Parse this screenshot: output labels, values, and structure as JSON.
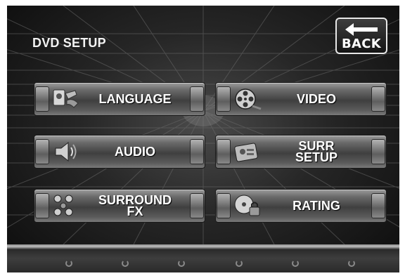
{
  "screen": {
    "title": "DVD SETUP"
  },
  "back_button": {
    "label": "BACK"
  },
  "menu": {
    "language": {
      "label": "LANGUAGE",
      "icon": "language-icon"
    },
    "video": {
      "label": "VIDEO",
      "icon": "film-reel-icon"
    },
    "audio": {
      "label": "AUDIO",
      "icon": "speaker-icon"
    },
    "surr_setup": {
      "label": "SURR\nSETUP",
      "icon": "surround-setup-icon"
    },
    "surround_fx": {
      "label": "SURROUND\nFX",
      "icon": "surround-speakers-icon"
    },
    "rating": {
      "label": "RATING",
      "icon": "disc-lock-icon"
    }
  }
}
